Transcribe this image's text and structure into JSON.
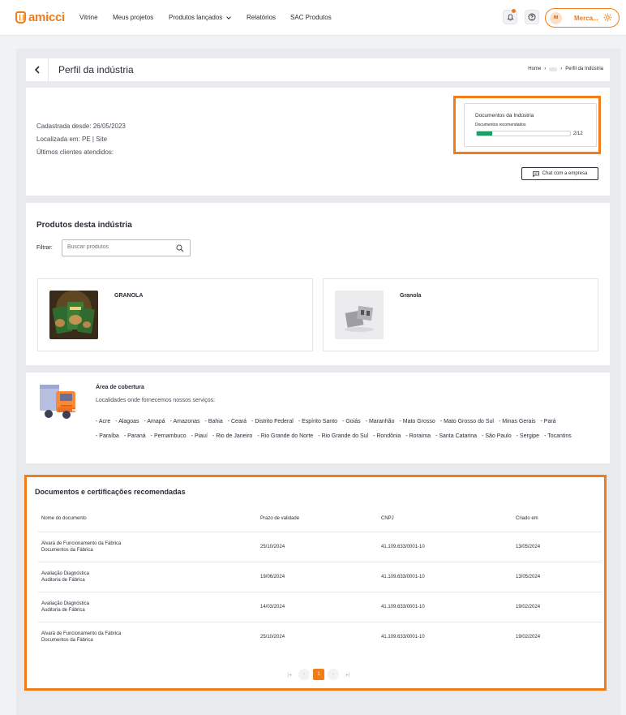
{
  "nav": {
    "logo": "amicci",
    "links": [
      "Vitrine",
      "Meus projetos",
      "Produtos lançados",
      "Relatórios",
      "SAC Produtos"
    ],
    "user_initials": "IM",
    "user_name": "Merca..."
  },
  "header": {
    "title": "Perfil da indústria",
    "breadcrumb_home": "Home",
    "breadcrumb_current": "Perfil da Indústria"
  },
  "info": {
    "registered": "Cadastrada desde: 26/05/2023",
    "location": "Localizada em: PE | Site",
    "clients": "Últimos clientes atendidos:",
    "docs_title": "Documentos da Indústria",
    "docs_subtitle": "Documentos recomendados",
    "docs_progress_text": "2/12",
    "docs_progress_fraction": 0.1667,
    "progress_color": "#1c9e67",
    "chat_button": "Chat com a empresa"
  },
  "products": {
    "title": "Produtos desta indústria",
    "filter_label": "Filtrar:",
    "search_placeholder": "Buscar produtos",
    "items": [
      {
        "name": "GRANOLA",
        "image": "granola-package-photo"
      },
      {
        "name": "Granola",
        "image": "placeholder-image"
      }
    ]
  },
  "coverage": {
    "title": "Área de cobertura",
    "subtitle": "Localidades onde fornecemos nossos serviços:",
    "states": [
      "Acre",
      "Alagoas",
      "Amapá",
      "Amazonas",
      "Bahia",
      "Ceará",
      "Distrito Federal",
      "Espírito Santo",
      "Goiás",
      "Maranhão",
      "Mato Grosso",
      "Mato Grosso do Sul",
      "Minas Gerais",
      "Pará",
      "Paraíba",
      "Paraná",
      "Pernambuco",
      "Piauí",
      "Rio de Janeiro",
      "Rio Grande do Norte",
      "Rio Grande do Sul",
      "Rondônia",
      "Roraima",
      "Santa Catarina",
      "São Paulo",
      "Sergipe",
      "Tocantins"
    ]
  },
  "documents": {
    "title": "Documentos e certificações recomendadas",
    "columns": [
      "Nome do documento",
      "Prazo de validade",
      "CNPJ",
      "Criado em"
    ],
    "rows": [
      {
        "name": "Alvará de Funcionamento da Fábrica",
        "category": "Documentos da Fábrica",
        "validity": "25/10/2024",
        "cnpj": "41.109.633/0001-10",
        "created": "13/05/2024"
      },
      {
        "name": "Avaliação Diagnóstica",
        "category": "Auditoria de Fábrica",
        "validity": "19/06/2024",
        "cnpj": "41.109.633/0001-10",
        "created": "13/05/2024"
      },
      {
        "name": "Avaliação Diagnóstica",
        "category": "Auditoria de Fábrica",
        "validity": "14/03/2024",
        "cnpj": "41.109.633/0001-10",
        "created": "19/02/2024"
      },
      {
        "name": "Alvará de Funcionamento da Fábrica",
        "category": "Documentos da Fábrica",
        "validity": "25/10/2024",
        "cnpj": "41.109.633/0001-10",
        "created": "19/02/2024"
      }
    ],
    "pagination": {
      "current_page": "1"
    }
  },
  "colors": {
    "accent": "#f07c1a",
    "text": "#2b2b38"
  }
}
